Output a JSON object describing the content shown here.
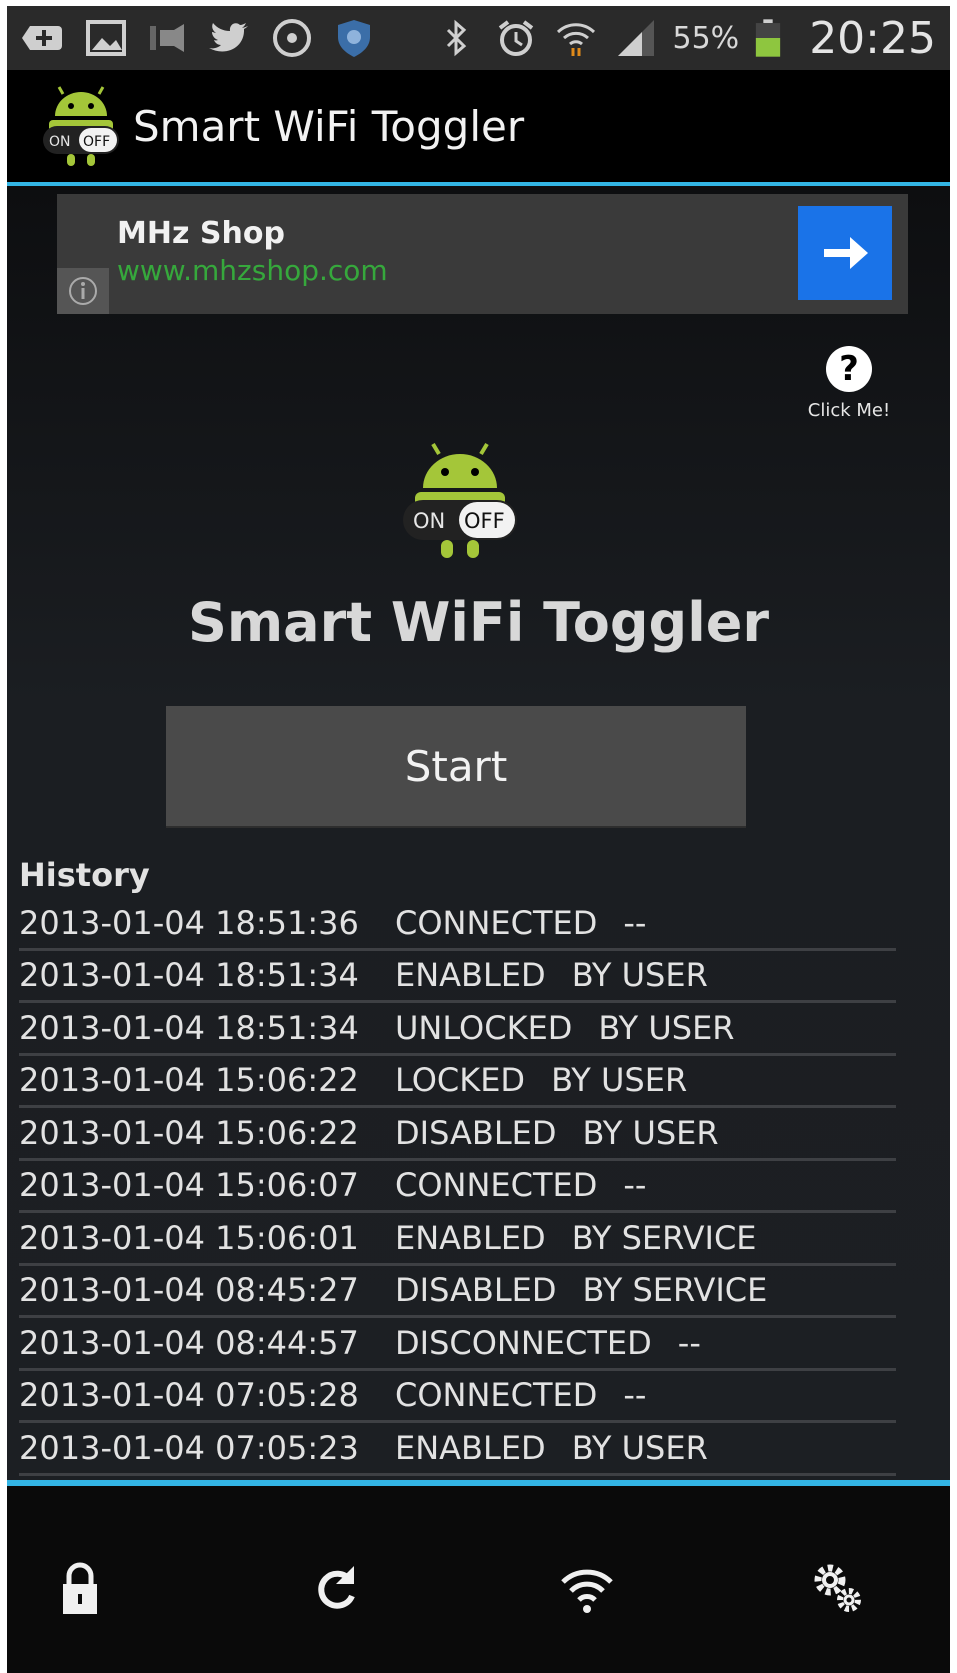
{
  "status_bar": {
    "battery_percent": "55%",
    "time": "20:25",
    "icons_left": [
      "add-icon",
      "image-icon",
      "ftp-icon",
      "twitter-icon",
      "record-icon",
      "shield-icon"
    ],
    "icons_right": [
      "bluetooth-icon",
      "alarm-icon",
      "wifi-icon",
      "signal-icon",
      "battery-icon"
    ]
  },
  "action_bar": {
    "title": "Smart WiFi Toggler",
    "logo_on": "ON",
    "logo_off": "OFF"
  },
  "ad": {
    "title": "MHz Shop",
    "url": "www.mhzshop.com"
  },
  "help": {
    "icon": "?",
    "label": "Click Me!"
  },
  "main": {
    "logo_on": "ON",
    "logo_off": "OFF",
    "title": "Smart WiFi Toggler",
    "start_label": "Start"
  },
  "history": {
    "label": "History",
    "rows": [
      {
        "timestamp": "2013-01-04 18:51:36",
        "event": "CONNECTED",
        "source": "--"
      },
      {
        "timestamp": "2013-01-04 18:51:34",
        "event": "ENABLED",
        "source": "BY USER"
      },
      {
        "timestamp": "2013-01-04 18:51:34",
        "event": "UNLOCKED",
        "source": "BY USER"
      },
      {
        "timestamp": "2013-01-04 15:06:22",
        "event": "LOCKED",
        "source": "BY USER"
      },
      {
        "timestamp": "2013-01-04 15:06:22",
        "event": "DISABLED",
        "source": "BY USER"
      },
      {
        "timestamp": "2013-01-04 15:06:07",
        "event": "CONNECTED",
        "source": "--"
      },
      {
        "timestamp": "2013-01-04 15:06:01",
        "event": "ENABLED",
        "source": "BY SERVICE"
      },
      {
        "timestamp": "2013-01-04 08:45:27",
        "event": "DISABLED",
        "source": "BY SERVICE"
      },
      {
        "timestamp": "2013-01-04 08:44:57",
        "event": "DISCONNECTED",
        "source": "--"
      },
      {
        "timestamp": "2013-01-04 07:05:28",
        "event": "CONNECTED",
        "source": "--"
      },
      {
        "timestamp": "2013-01-04 07:05:23",
        "event": "ENABLED",
        "source": "BY USER"
      }
    ]
  },
  "bottom_nav": [
    "lock-icon",
    "refresh-icon",
    "wifi-icon",
    "settings-icon"
  ],
  "colors": {
    "accent": "#33b5e5",
    "ad_url": "#36a83c",
    "ad_arrow": "#1a73e8",
    "android_green": "#a4c639"
  }
}
